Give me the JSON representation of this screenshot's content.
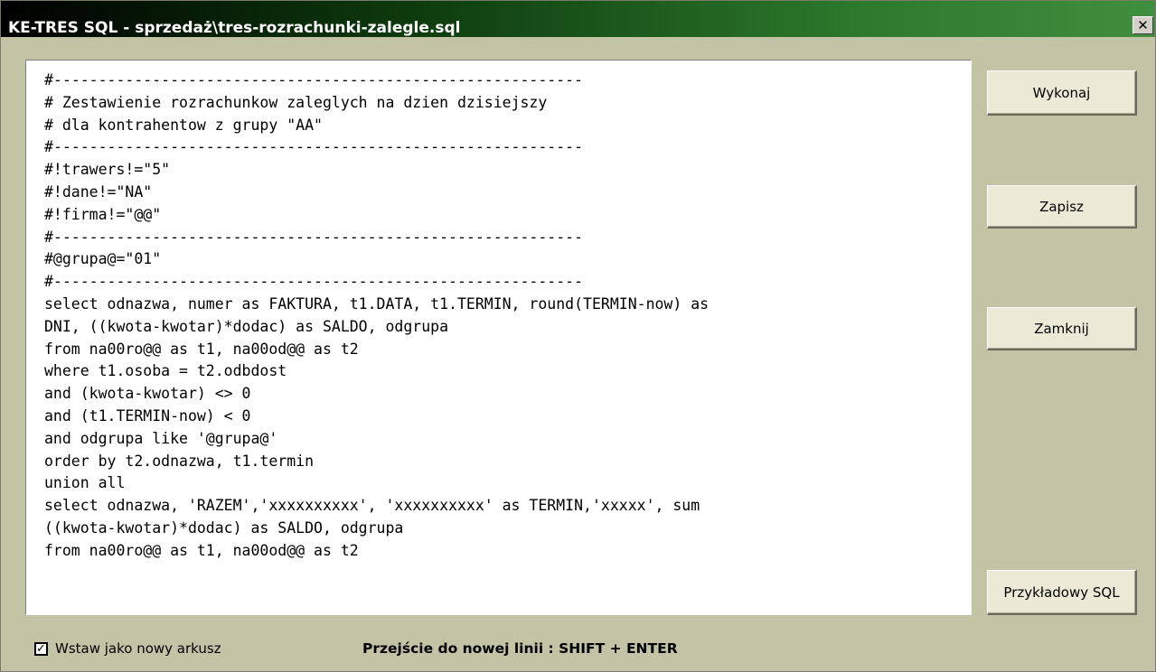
{
  "window": {
    "title": "KE-TRES SQL - sprzedaż\\tres-rozrachunki-zalegle.sql",
    "close_glyph": "✕"
  },
  "editor": {
    "lines": [
      "#-----------------------------------------------------------",
      "# Zestawienie rozrachunkow zaleglych na dzien dzisiejszy",
      "# dla kontrahentow z grupy \"AA\"",
      "#-----------------------------------------------------------",
      "#!trawers!=\"5\"",
      "#!dane!=\"NA\"",
      "#!firma!=\"@@\"",
      "#-----------------------------------------------------------",
      "#@grupa@=\"01\"",
      "#-----------------------------------------------------------",
      "select odnazwa, numer as FAKTURA, t1.DATA, t1.TERMIN, round(TERMIN-now) as",
      "DNI, ((kwota-kwotar)*dodac) as SALDO, odgrupa",
      "from na00ro@@ as t1, na00od@@ as t2",
      "where t1.osoba = t2.odbdost",
      "and (kwota-kwotar) <> 0",
      "and (t1.TERMIN-now) < 0",
      "and odgrupa like '@grupa@'",
      "order by t2.odnazwa, t1.termin",
      "union all",
      "select odnazwa, 'RAZEM','xxxxxxxxxx', 'xxxxxxxxxx' as TERMIN,'xxxxx', sum",
      "((kwota-kwotar)*dodac) as SALDO, odgrupa",
      "from na00ro@@ as t1, na00od@@ as t2"
    ]
  },
  "buttons": {
    "run_label": "Wykonaj",
    "save_label": "Zapisz",
    "close_label": "Zamknij",
    "sample_label": "Przykładowy SQL"
  },
  "options": {
    "new_sheet_label": "Wstaw jako nowy arkusz",
    "new_sheet_checked": true
  },
  "hint": "Przejście do nowej linii : SHIFT + ENTER",
  "colors": {
    "titlebar_start": "#000000",
    "titlebar_end": "#3e8f3e",
    "window_bg": "#c3c3a6"
  }
}
